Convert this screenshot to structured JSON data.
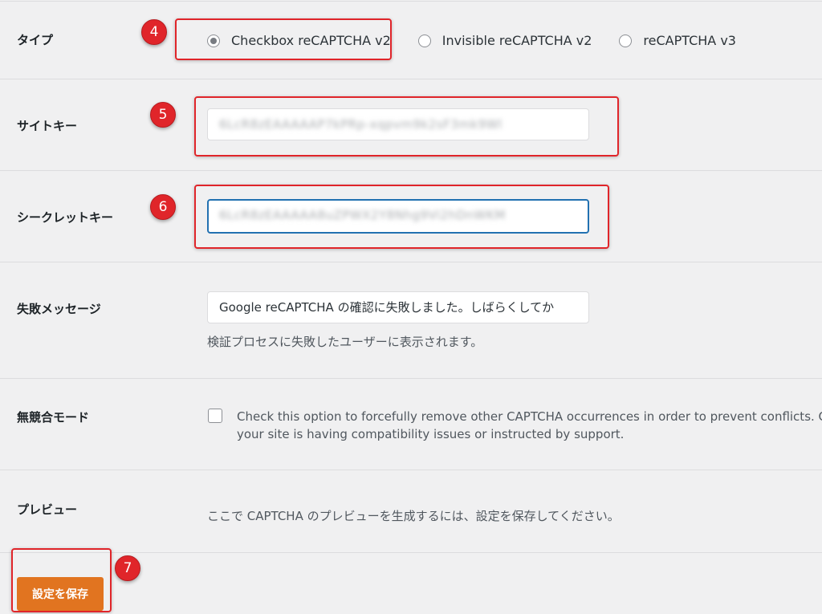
{
  "rows": {
    "type": {
      "label": "タイプ",
      "options": [
        {
          "label": "Checkbox reCAPTCHA v2",
          "checked": true
        },
        {
          "label": "Invisible reCAPTCHA v2",
          "checked": false
        },
        {
          "label": "reCAPTCHA v3",
          "checked": false
        }
      ]
    },
    "site_key": {
      "label": "サイトキー",
      "value": "6LcR8zEAAAAAP7kPRp-xqpvm9k2sF3mk9Wl"
    },
    "secret_key": {
      "label": "シークレットキー",
      "value": "6LcR8zEAAAAA8uZPWX2Y8Nhg9Vi2hDnWKM"
    },
    "fail_message": {
      "label": "失敗メッセージ",
      "value": "Google reCAPTCHA の確認に失敗しました。しばらくしてか",
      "help": "検証プロセスに失敗したユーザーに表示されます。"
    },
    "no_conflict": {
      "label": "無競合モード",
      "checked": false,
      "text_line1": "Check this option to forcefully remove other CAPTCHA occurrences in order to prevent conflicts. On",
      "text_line2": "your site is having compatibility issues or instructed by support."
    },
    "preview": {
      "label": "プレビュー",
      "text": "ここで CAPTCHA のプレビューを生成するには、設定を保存してください。"
    }
  },
  "save_button": "設定を保存",
  "badges": {
    "b4": "4",
    "b5": "5",
    "b6": "6",
    "b7": "7"
  },
  "colors": {
    "accent_button": "#e17420",
    "annotation_red": "#e0252a",
    "focus_blue": "#2271b1"
  }
}
